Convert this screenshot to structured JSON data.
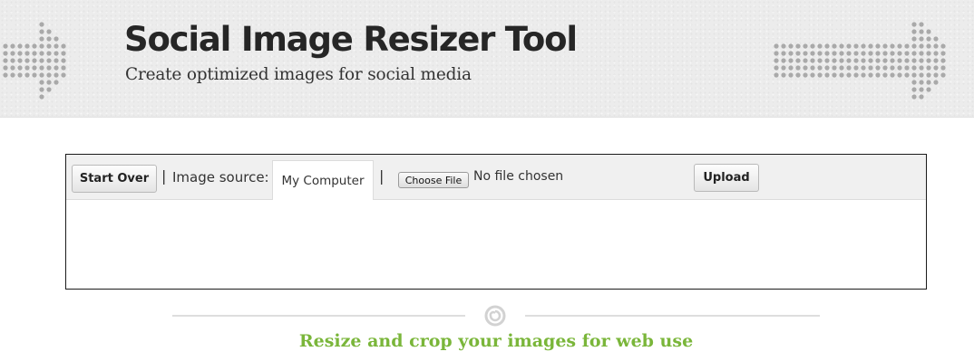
{
  "header": {
    "title": "Social Image Resizer Tool",
    "subtitle": "Create optimized images for social media",
    "decoration_icon": "dotted-arrow-icon"
  },
  "toolbar": {
    "start_over_label": "Start Over",
    "separator": "|",
    "image_source_label": "Image source:",
    "source_tab_label": "My Computer",
    "choose_file_label": "Choose File",
    "file_status": "No file chosen",
    "upload_label": "Upload"
  },
  "footer": {
    "divider_icon": "swirl-icon",
    "tagline": "Resize and crop your images for web use"
  },
  "colors": {
    "tagline": "#7ab63a",
    "header_bg": "#ececec",
    "panel_border": "#1b1b1b",
    "dots": "#a9a9a9"
  }
}
